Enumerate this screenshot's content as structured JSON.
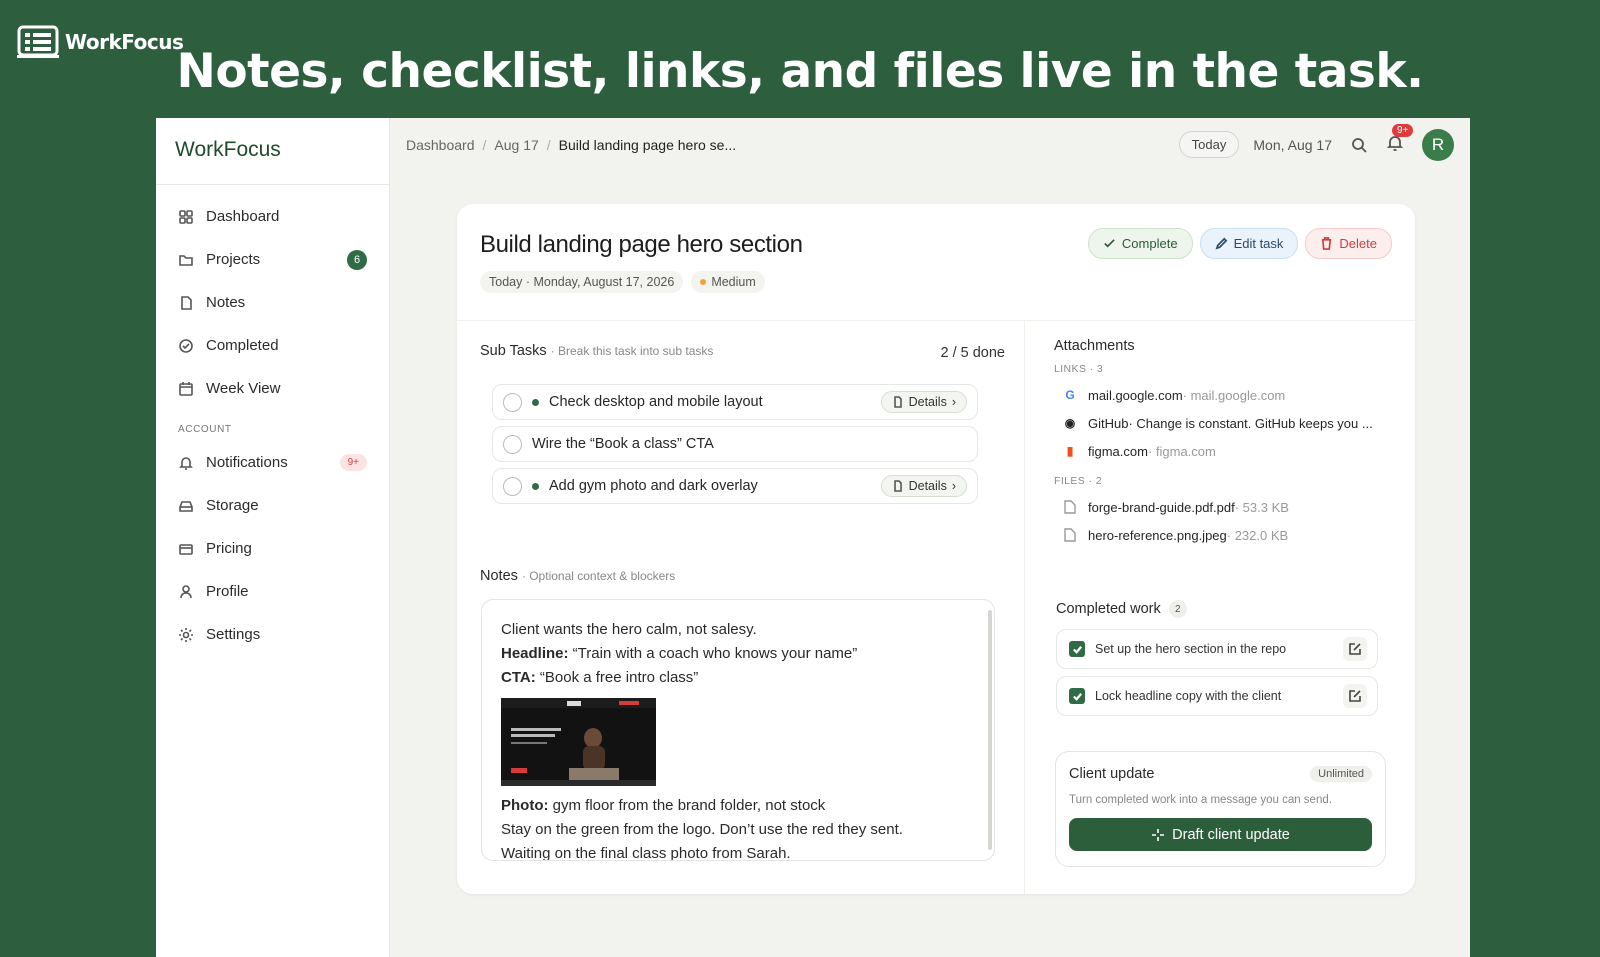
{
  "banner": {
    "brand": "WorkFocus",
    "headline": "Notes, checklist, links, and files live in the task."
  },
  "sidebar": {
    "title": "WorkFocus",
    "items": [
      {
        "label": "Dashboard",
        "icon": "grid-icon"
      },
      {
        "label": "Projects",
        "icon": "folder-icon",
        "badge": "6"
      },
      {
        "label": "Notes",
        "icon": "file-icon"
      },
      {
        "label": "Completed",
        "icon": "check-circle-icon"
      },
      {
        "label": "Week View",
        "icon": "calendar-icon"
      }
    ],
    "account_label": "ACCOUNT",
    "account_items": [
      {
        "label": "Notifications",
        "icon": "bell-icon",
        "badge": "9+"
      },
      {
        "label": "Storage",
        "icon": "storage-icon"
      },
      {
        "label": "Pricing",
        "icon": "card-icon"
      },
      {
        "label": "Profile",
        "icon": "user-icon"
      },
      {
        "label": "Settings",
        "icon": "gear-icon"
      }
    ]
  },
  "topbar": {
    "breadcrumbs": [
      "Dashboard",
      "Aug 17",
      "Build landing page hero se..."
    ],
    "separator": "/",
    "today_label": "Today",
    "date": "Mon, Aug 17",
    "notif_badge": "9+",
    "avatar_initial": "R"
  },
  "task": {
    "title": "Build landing page hero section",
    "due": "Today · Monday, August 17, 2026",
    "priority": "Medium",
    "actions": {
      "complete": "Complete",
      "edit": "Edit task",
      "delete": "Delete"
    }
  },
  "subtasks": {
    "title": "Sub Tasks",
    "subtitle": "· Break this task into sub tasks",
    "progress": "2 / 5 done",
    "details_label": "Details",
    "items": [
      {
        "label": "Check desktop and mobile layout",
        "has_details": true
      },
      {
        "label": "Wire the “Book a class” CTA",
        "has_details": false
      },
      {
        "label": "Add gym photo and dark overlay",
        "has_details": true
      }
    ]
  },
  "notes": {
    "title": "Notes",
    "subtitle": "· Optional context & blockers",
    "line1": "Client wants the hero calm, not salesy.",
    "headline_label": "Headline:",
    "headline_text": " “Train with a coach who knows your name”",
    "cta_label": "CTA:",
    "cta_text": " “Book a free intro class”",
    "photo_label": "Photo:",
    "photo_text": " gym floor from the brand folder, not stock",
    "line5": "Stay on the green from the logo. Don’t use the red they sent.",
    "line6": "Waiting on the final class photo from Sarah."
  },
  "attachments": {
    "title": "Attachments",
    "links_label": "LINKS · 3",
    "links": [
      {
        "icon": "G",
        "name": "mail.google.com",
        "desc": " · mail.google.com",
        "color": "#4285f4"
      },
      {
        "icon": "◉",
        "name": "GitHub",
        "desc": " · Change is constant. GitHub keeps you ...",
        "color": "#222222"
      },
      {
        "icon": "▮",
        "name": "figma.com",
        "desc": " · figma.com",
        "color": "#f24e1e"
      }
    ],
    "files_label": "FILES · 2",
    "files": [
      {
        "name": "forge-brand-guide.pdf.pdf",
        "size": " · 53.3 KB"
      },
      {
        "name": "hero-reference.png.jpeg",
        "size": " · 232.0 KB"
      }
    ]
  },
  "completed_work": {
    "title": "Completed work",
    "count": "2",
    "items": [
      "Set up the hero section in the repo",
      "Lock headline copy with the client"
    ]
  },
  "client_update": {
    "title": "Client update",
    "badge": "Unlimited",
    "subtitle": "Turn completed work into a message you can send.",
    "button": "Draft client update"
  },
  "colors": {
    "brand_green": "#2d5e3e",
    "accent": "#2f6b45",
    "danger": "#e03a3a"
  }
}
